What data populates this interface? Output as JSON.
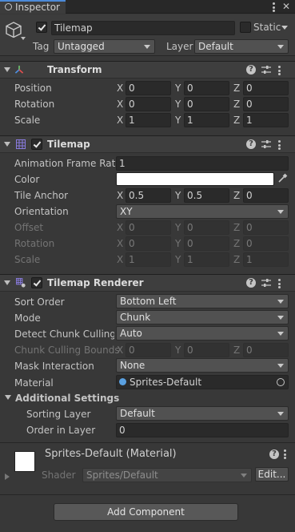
{
  "tab": {
    "label": "Inspector"
  },
  "object": {
    "name": "Tilemap",
    "static_label": "Static",
    "tag_label": "Tag",
    "tag_value": "Untagged",
    "layer_label": "Layer",
    "layer_value": "Default"
  },
  "transform": {
    "title": "Transform",
    "rows": [
      {
        "label": "Position",
        "x": "0",
        "y": "0",
        "z": "0"
      },
      {
        "label": "Rotation",
        "x": "0",
        "y": "0",
        "z": "0"
      },
      {
        "label": "Scale",
        "x": "1",
        "y": "1",
        "z": "1"
      }
    ]
  },
  "axes": {
    "x": "X",
    "y": "Y",
    "z": "Z"
  },
  "tilemap": {
    "title": "Tilemap",
    "anim_label": "Animation Frame Rate",
    "anim_value": "1",
    "color_label": "Color",
    "color_value": "#ffffff",
    "anchor_label": "Tile Anchor",
    "anchor_x": "0.5",
    "anchor_y": "0.5",
    "anchor_z": "0",
    "orientation_label": "Orientation",
    "orientation_value": "XY",
    "offset_label": "Offset",
    "offset": {
      "x": "0",
      "y": "0",
      "z": "0"
    },
    "rotation_label": "Rotation",
    "rotation": {
      "x": "0",
      "y": "0",
      "z": "0"
    },
    "scale_label": "Scale",
    "scale": {
      "x": "1",
      "y": "1",
      "z": "1"
    }
  },
  "renderer": {
    "title": "Tilemap Renderer",
    "sort_label": "Sort Order",
    "sort_value": "Bottom Left",
    "mode_label": "Mode",
    "mode_value": "Chunk",
    "culling_label": "Detect Chunk Culling I",
    "culling_value": "Auto",
    "bounds_label": "Chunk Culling Bounds",
    "bounds": {
      "x": "0",
      "y": "0",
      "z": "0"
    },
    "mask_label": "Mask Interaction",
    "mask_value": "None",
    "material_label": "Material",
    "material_value": "Sprites-Default",
    "additional_label": "Additional Settings",
    "sorting_layer_label": "Sorting Layer",
    "sorting_layer_value": "Default",
    "order_label": "Order in Layer",
    "order_value": "0"
  },
  "material_section": {
    "title": "Sprites-Default (Material)",
    "shader_label": "Shader",
    "shader_value": "Sprites/Default",
    "edit_label": "Edit..."
  },
  "add_component_label": "Add Component",
  "colors": {
    "panel": "#383838",
    "header": "#3e3e3e",
    "field": "#2a2a2a",
    "dropdown": "#515151"
  }
}
